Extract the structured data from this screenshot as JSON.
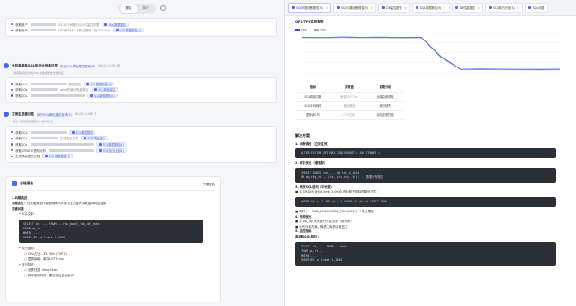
{
  "topbar": {
    "seg_a": "报告",
    "seg_b": "执行",
    "workspace": "工作空间"
  },
  "left": {
    "block1_rows": [
      {
        "prefix": "获取用户",
        "mid": "03:20:16报告SQL的监控数据",
        "chip": "SQL数据报告"
      },
      {
        "prefix": "获取用户",
        "mid": "TPS和ORACLE执行报告以及TOP SQL",
        "chip": "SQL数据报告(5)"
      }
    ],
    "agent1": {
      "name": "分析高消耗SQL执行计划建议性",
      "link": "执行SQL调优建议查询(8)",
      "time": "08-20 17:59:18"
    },
    "agent1_desc": "分析需要建议优化SQL的数据报告性能特征",
    "block2_rows": [
      {
        "prefix": "获取SQL",
        "mid": "数据报告",
        "chip": "SQL数据报告(4)"
      },
      {
        "prefix": "获取SQL",
        "mid": "raise的索引性能建议",
        "chip": "SQL调优建议"
      },
      {
        "prefix": "获取SQL",
        "mid": "",
        "chip": "SQL数据报告(1)"
      }
    ],
    "agent2": {
      "name": "方案生成建议性",
      "link": "执行SQL调优建议查询(5)",
      "time": "08-20 21:08:57"
    },
    "agent2_desc": "结合分析结果整理调优方案与建议",
    "block3_rows": [
      {
        "prefix": "获取SQL",
        "mid": "",
        "chip": "SQL数据报告"
      },
      {
        "prefix": "获取SQL",
        "mid": "生成建议方案",
        "chip": "SQL调优建议"
      },
      {
        "prefix": "获取SQL",
        "mid": "",
        "chip": "SQL数据报告(1)"
      },
      {
        "prefix": "获取UPDATE语句分析",
        "mid": "",
        "chip": "SQL执行计划(1)"
      },
      {
        "prefix": "生成调优建议文档",
        "mid": "",
        "chip": "SQL数据报告(1)"
      }
    ],
    "doc": {
      "title": "总结报告",
      "download": "下载报告",
      "h1": "1.问题描述",
      "summary_label": "问题定位：",
      "summary_text": "在数据库运行高峰期间SQL执行压力增大导致整体响应变慢",
      "subhead": "关键问题",
      "bullet1": "• SQL文本：",
      "code": [
        "SELECT id, ... FROM ...raw_model_tag_dt_data",
        "FROM op_rt...",
        "WHERE ...",
        "ORDER BY id limit 1,1000"
      ],
      "bullet2": "• 执行指标：",
      "m1": "○ CPU占比：33.78% (TOP1)",
      "m2": "○ 逻辑读取：单次15774ms",
      "bullet3": "• 执行特征：",
      "f1": "○ 全表扫描（Seq Scan）",
      "f2": "○ 排序使用内存，建议添加合适索引"
    }
  },
  "right": {
    "tabs": [
      "SQL问题诊断报告(5)",
      "SQL问题诊断报告(5)",
      "DB监控报告",
      "SQL数据报告(5)",
      "DB性能报告",
      "SQL执行计划(5)",
      "SQL问题"
    ],
    "chart_title": "QPS/TPS实时趋势",
    "legend": [
      "QPS",
      "TPS"
    ],
    "table": {
      "headers": [
        "指标",
        "异常值",
        "初期分析"
      ],
      "rows": [
        [
          "SQL调用次数",
          "峰值2577/hs",
          "出现高频调用"
        ],
        [
          "SQL平均耗时",
          "接近阈值",
          "索引缺失"
        ],
        [
          "逻辑读CPU",
          "CPU占比",
          "存在全表扫描"
        ]
      ]
    },
    "sol_title": "解决方案",
    "s1": "1. 参数调优（立即生效）",
    "s1_code": "ALTER SYSTEM SET MAX_CONCURRENT = 100 TENANT =",
    "s2": "2. 索引优化（增强配）",
    "s2_code1": "CREATE INDEX idx_... ON tbl_x_data",
    "s2_code2": "ON op_rtg_xd... (id, biz_key, dt); -- 数据分布相关",
    "s3": "3. 修改SQL语句（中长期）",
    "s3_line": "■ 将 ORDER BY id limit 1,0000 改为基于游标的翻页方式：",
    "s3_code": "WHERE id >= ? AND id < ? ORDER BY dt,id LIMIT 1000",
    "s3_note": "■ 同时 /*+ MAX_EXECUTION_TIME(5000) */ 防止雪崩",
    "s4": "4. 架构优化",
    "s4_a": "■ 对 op_rtg 大表进行分区归档（按月份）",
    "s4_b": "■ 读写分离方案，降低主库的并发压力",
    "s5": "5. 监控指标",
    "s6": "高消耗SQL特征：",
    "s6_code": [
      "SELECT id, ... FROM ...data",
      "FROM op_rt...",
      "WHERE ...",
      "ORDER BY id limit 1,1000"
    ]
  },
  "chart_data": {
    "type": "line",
    "title": "QPS/TPS实时趋势",
    "series": [
      {
        "name": "QPS",
        "values": [
          270,
          268,
          272,
          269,
          271,
          268,
          270,
          120,
          20,
          22,
          21,
          20,
          20,
          21
        ]
      },
      {
        "name": "TPS",
        "values": [
          266,
          264,
          267,
          265,
          266,
          263,
          265,
          112,
          16,
          17,
          16,
          16,
          15,
          16
        ]
      }
    ],
    "ylim": [
      0,
      300
    ]
  }
}
